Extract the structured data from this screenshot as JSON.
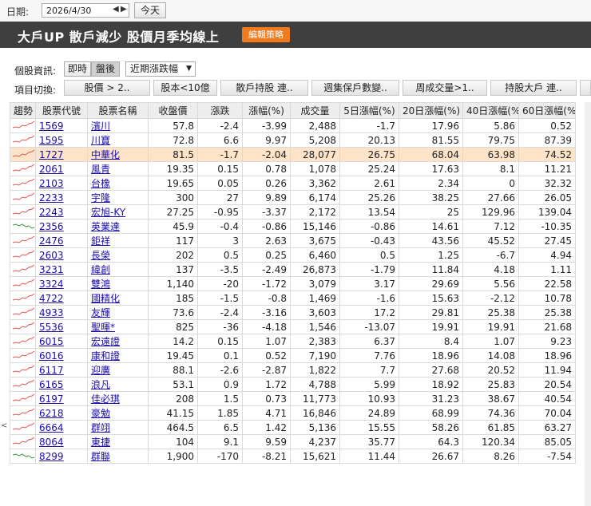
{
  "datebar": {
    "label": "日期:",
    "date_value": "2026/4/30",
    "prev_arrow": "◀",
    "next_arrow": "▶",
    "today_label": "今天"
  },
  "titlebar": {
    "title": "大戶UP 散戶減少  股價月季均線上",
    "edit_label": "編輯策略"
  },
  "controls": {
    "stock_info_label": "個股資訊:",
    "realtime_label": "即時",
    "afterhours_label": "盤後",
    "select_value": "近期漲跌幅",
    "switch_label": "項目切換:",
    "tabs": [
      "股價 > 2..",
      "股本<10億",
      "散戶持股 連..",
      "週集保戶數變..",
      "周成交量>1..",
      "持股大戶 連.."
    ]
  },
  "colors": {
    "up_spark": "#e05555",
    "down_spark": "#2e9a3c",
    "highlight_row": "#fde3c8",
    "edit_button": "#f07a1e"
  },
  "table": {
    "headers": [
      "趨勢",
      "股票代號",
      "股票名稱",
      "收盤價",
      "漲跌",
      "漲幅(%)",
      "成交量",
      "5日漲幅(%)",
      "20日漲幅(%)",
      "40日漲幅(%)",
      "60日漲幅(%)"
    ],
    "rows": [
      {
        "code": "1569",
        "name": "濱川",
        "close": "57.8",
        "chg": "-2.4",
        "pct": "-3.99",
        "vol": "2,488",
        "d5": "-1.7",
        "d20": "17.96",
        "d40": "5.86",
        "d60": "0.52",
        "trend": "up",
        "hl": false
      },
      {
        "code": "1595",
        "name": "川寶",
        "close": "72.8",
        "chg": "6.6",
        "pct": "9.97",
        "vol": "5,208",
        "d5": "20.13",
        "d20": "81.55",
        "d40": "79.75",
        "d60": "87.39",
        "trend": "up",
        "hl": false
      },
      {
        "code": "1727",
        "name": "中華化",
        "close": "81.5",
        "chg": "-1.7",
        "pct": "-2.04",
        "vol": "28,077",
        "d5": "26.75",
        "d20": "68.04",
        "d40": "63.98",
        "d60": "74.52",
        "trend": "up",
        "hl": true
      },
      {
        "code": "2061",
        "name": "風青",
        "close": "19.35",
        "chg": "0.15",
        "pct": "0.78",
        "vol": "1,078",
        "d5": "25.24",
        "d20": "17.63",
        "d40": "8.1",
        "d60": "11.21",
        "trend": "up",
        "hl": false
      },
      {
        "code": "2103",
        "name": "台橡",
        "close": "19.65",
        "chg": "0.05",
        "pct": "0.26",
        "vol": "3,362",
        "d5": "2.61",
        "d20": "2.34",
        "d40": "0",
        "d60": "32.32",
        "trend": "up",
        "hl": false
      },
      {
        "code": "2233",
        "name": "宇隆",
        "close": "300",
        "chg": "27",
        "pct": "9.89",
        "vol": "6,174",
        "d5": "25.26",
        "d20": "38.25",
        "d40": "27.66",
        "d60": "26.05",
        "trend": "up",
        "hl": false
      },
      {
        "code": "2243",
        "name": "宏旭-KY",
        "close": "27.25",
        "chg": "-0.95",
        "pct": "-3.37",
        "vol": "2,172",
        "d5": "13.54",
        "d20": "25",
        "d40": "129.96",
        "d60": "139.04",
        "trend": "up",
        "hl": false
      },
      {
        "code": "2356",
        "name": "英業達",
        "close": "45.9",
        "chg": "-0.4",
        "pct": "-0.86",
        "vol": "15,146",
        "d5": "-0.86",
        "d20": "14.61",
        "d40": "7.12",
        "d60": "-10.35",
        "trend": "down",
        "hl": false
      },
      {
        "code": "2476",
        "name": "鉅祥",
        "close": "117",
        "chg": "3",
        "pct": "2.63",
        "vol": "3,675",
        "d5": "-0.43",
        "d20": "43.56",
        "d40": "45.52",
        "d60": "27.45",
        "trend": "up",
        "hl": false
      },
      {
        "code": "2603",
        "name": "長榮",
        "close": "202",
        "chg": "0.5",
        "pct": "0.25",
        "vol": "6,460",
        "d5": "0.5",
        "d20": "1.25",
        "d40": "-6.7",
        "d60": "4.94",
        "trend": "up",
        "hl": false
      },
      {
        "code": "3231",
        "name": "緯創",
        "close": "137",
        "chg": "-3.5",
        "pct": "-2.49",
        "vol": "26,873",
        "d5": "-1.79",
        "d20": "11.84",
        "d40": "4.18",
        "d60": "1.11",
        "trend": "up",
        "hl": false
      },
      {
        "code": "3324",
        "name": "雙鴻",
        "close": "1,140",
        "chg": "-20",
        "pct": "-1.72",
        "vol": "3,079",
        "d5": "3.17",
        "d20": "29.69",
        "d40": "5.56",
        "d60": "22.58",
        "trend": "up",
        "hl": false
      },
      {
        "code": "4722",
        "name": "國精化",
        "close": "185",
        "chg": "-1.5",
        "pct": "-0.8",
        "vol": "1,469",
        "d5": "-1.6",
        "d20": "15.63",
        "d40": "-2.12",
        "d60": "10.78",
        "trend": "up",
        "hl": false
      },
      {
        "code": "4933",
        "name": "友輝",
        "close": "73.6",
        "chg": "-2.4",
        "pct": "-3.16",
        "vol": "3,603",
        "d5": "17.2",
        "d20": "29.81",
        "d40": "25.38",
        "d60": "25.38",
        "trend": "up",
        "hl": false
      },
      {
        "code": "5536",
        "name": "聖暉*",
        "close": "825",
        "chg": "-36",
        "pct": "-4.18",
        "vol": "1,546",
        "d5": "-13.07",
        "d20": "19.91",
        "d40": "19.91",
        "d60": "21.68",
        "trend": "up",
        "hl": false
      },
      {
        "code": "6015",
        "name": "宏遠證",
        "close": "14.2",
        "chg": "0.15",
        "pct": "1.07",
        "vol": "2,383",
        "d5": "6.37",
        "d20": "8.4",
        "d40": "1.07",
        "d60": "9.23",
        "trend": "up",
        "hl": false
      },
      {
        "code": "6016",
        "name": "康和證",
        "close": "19.45",
        "chg": "0.1",
        "pct": "0.52",
        "vol": "7,190",
        "d5": "7.76",
        "d20": "18.96",
        "d40": "14.08",
        "d60": "18.96",
        "trend": "up",
        "hl": false
      },
      {
        "code": "6117",
        "name": "迎廣",
        "close": "88.1",
        "chg": "-2.6",
        "pct": "-2.87",
        "vol": "1,822",
        "d5": "7.7",
        "d20": "27.68",
        "d40": "20.52",
        "d60": "11.94",
        "trend": "up",
        "hl": false
      },
      {
        "code": "6165",
        "name": "浪凡",
        "close": "53.1",
        "chg": "0.9",
        "pct": "1.72",
        "vol": "4,788",
        "d5": "5.99",
        "d20": "18.92",
        "d40": "25.83",
        "d60": "20.54",
        "trend": "up",
        "hl": false
      },
      {
        "code": "6197",
        "name": "佳必琪",
        "close": "208",
        "chg": "1.5",
        "pct": "0.73",
        "vol": "11,773",
        "d5": "10.93",
        "d20": "31.23",
        "d40": "38.67",
        "d60": "40.54",
        "trend": "up",
        "hl": false
      },
      {
        "code": "6218",
        "name": "豪勉",
        "close": "41.15",
        "chg": "1.85",
        "pct": "4.71",
        "vol": "16,846",
        "d5": "24.89",
        "d20": "68.99",
        "d40": "74.36",
        "d60": "70.04",
        "trend": "up",
        "hl": false
      },
      {
        "code": "6664",
        "name": "群翊",
        "close": "464.5",
        "chg": "6.5",
        "pct": "1.42",
        "vol": "5,136",
        "d5": "15.55",
        "d20": "58.26",
        "d40": "61.85",
        "d60": "63.27",
        "trend": "up",
        "hl": false
      },
      {
        "code": "8064",
        "name": "東捷",
        "close": "104",
        "chg": "9.1",
        "pct": "9.59",
        "vol": "4,237",
        "d5": "35.77",
        "d20": "64.3",
        "d40": "120.34",
        "d60": "85.05",
        "trend": "up",
        "hl": false
      },
      {
        "code": "8299",
        "name": "群聯",
        "close": "1,900",
        "chg": "-170",
        "pct": "-8.21",
        "vol": "15,621",
        "d5": "11.44",
        "d20": "26.67",
        "d40": "8.26",
        "d60": "-7.54",
        "trend": "down",
        "hl": false
      }
    ]
  }
}
